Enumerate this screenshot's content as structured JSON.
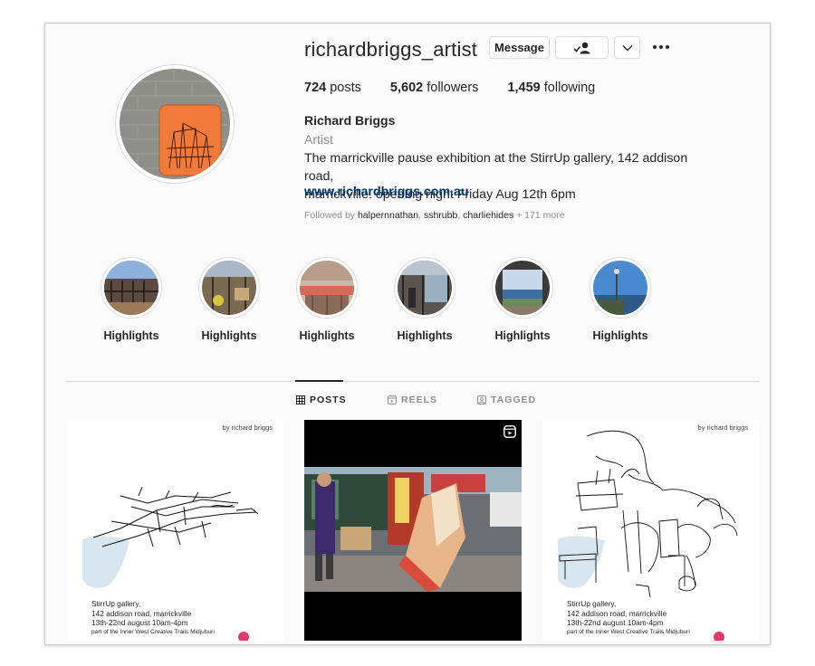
{
  "profile": {
    "username": "richardbriggs_artist",
    "message_label": "Message",
    "stats": {
      "posts_count": "724",
      "posts_label": "posts",
      "followers_count": "5,602",
      "followers_label": "followers",
      "following_count": "1,459",
      "following_label": "following"
    },
    "name": "Richard Briggs",
    "category": "Artist",
    "bio_line1": "The marrickville pause exhibition at the StirrUp gallery, 142 addison road,",
    "bio_line2": "marrickville. openIng night Friday Aug 12th 6pm",
    "website": "www.richardbriggs.com.au",
    "followed_by_prefix": "Followed by",
    "followed_by_users": [
      "halpernnathan",
      "sshrubb",
      "charliehides"
    ],
    "followed_by_more": "+ 171 more"
  },
  "highlights": [
    {
      "label": "Highlights",
      "icon": "highlight-image"
    },
    {
      "label": "Highlights",
      "icon": "highlight-image"
    },
    {
      "label": "Highlights",
      "icon": "highlight-image"
    },
    {
      "label": "Highlights",
      "icon": "highlight-image"
    },
    {
      "label": "Highlights",
      "icon": "highlight-image"
    },
    {
      "label": "Highlights",
      "icon": "highlight-image"
    }
  ],
  "tabs": [
    {
      "label": "POSTS",
      "icon": "grid-icon",
      "active": true
    },
    {
      "label": "REELS",
      "icon": "reels-icon",
      "active": false
    },
    {
      "label": "TAGGED",
      "icon": "tagged-icon",
      "active": false
    }
  ],
  "posts": [
    {
      "byline": "by richard briggs",
      "caption": [
        "StirrUp gallery,",
        "142 addison road, marrickville",
        "13th-22nd august 10am-4pm",
        "part of the Inner West Creative Trails Midjuburi"
      ]
    },
    {
      "type_icon": "reel-icon"
    },
    {
      "byline": "by richard briggs",
      "caption": [
        "StirrUp gallery,",
        "142 addison road, marrickville",
        "13th-22nd august 10am-4pm",
        "part of the Inner West Creative Trails Midjuburi"
      ]
    }
  ],
  "colors": {
    "link": "#00376b",
    "muted": "#8e8e8e",
    "text": "#262626",
    "border": "#dbdbdb",
    "background": "#fafafa"
  }
}
